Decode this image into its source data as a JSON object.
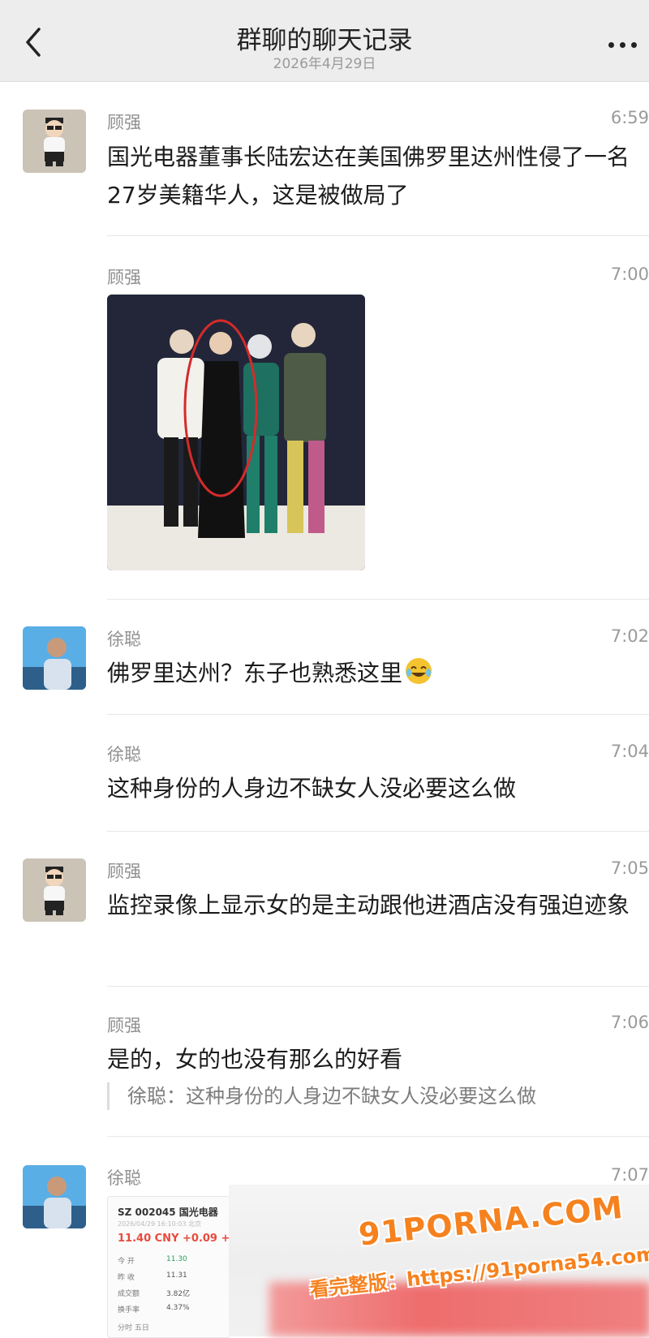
{
  "header": {
    "title": "群聊的聊天记录",
    "subtitle": "2026年4月29日"
  },
  "messages": [
    {
      "sender": "顾强",
      "time": "6:59",
      "text": "国光电器董事长陆宏达在美国佛罗里达州性侵了一名27岁美籍华人，这是被做局了"
    },
    {
      "sender": "顾强",
      "time": "7:00",
      "image": "group-photo"
    },
    {
      "sender": "徐聪",
      "time": "7:02",
      "text": "佛罗里达州？东子也熟悉这里",
      "emoji": "laughing-crying-emoji"
    },
    {
      "sender": "徐聪",
      "time": "7:04",
      "text": "这种身份的人身边不缺女人没必要这么做"
    },
    {
      "sender": "顾强",
      "time": "7:05",
      "text": "监控录像上显示女的是主动跟他进酒店没有强迫迹象"
    },
    {
      "sender": "顾强",
      "time": "7:06",
      "text": "是的，女的也没有那么的好看",
      "quote": "徐聪：这种身份的人身边不缺女人没必要这么做"
    },
    {
      "sender": "徐聪",
      "time": "7:07",
      "image": "stock-screenshot"
    }
  ],
  "stock_card": {
    "code": "SZ 002045  国光电器",
    "sub": "2026/04/29 16:10:03 北京",
    "price": "11.40 CNY +0.09 +0.",
    "rows": [
      {
        "label": "今 开",
        "value": "11.30"
      },
      {
        "label": "昨 收",
        "value": "11.31"
      },
      {
        "label": "成交额",
        "value": "3.82亿"
      },
      {
        "label": "换手率",
        "value": "4.37%"
      }
    ],
    "tabs": "分时      五日"
  },
  "watermark": {
    "logo": "91PORNA.COM",
    "url": "看完整版：https://91porna54.com"
  },
  "icons": {
    "back": "chevron-left-icon",
    "more": "more-dots-icon"
  }
}
